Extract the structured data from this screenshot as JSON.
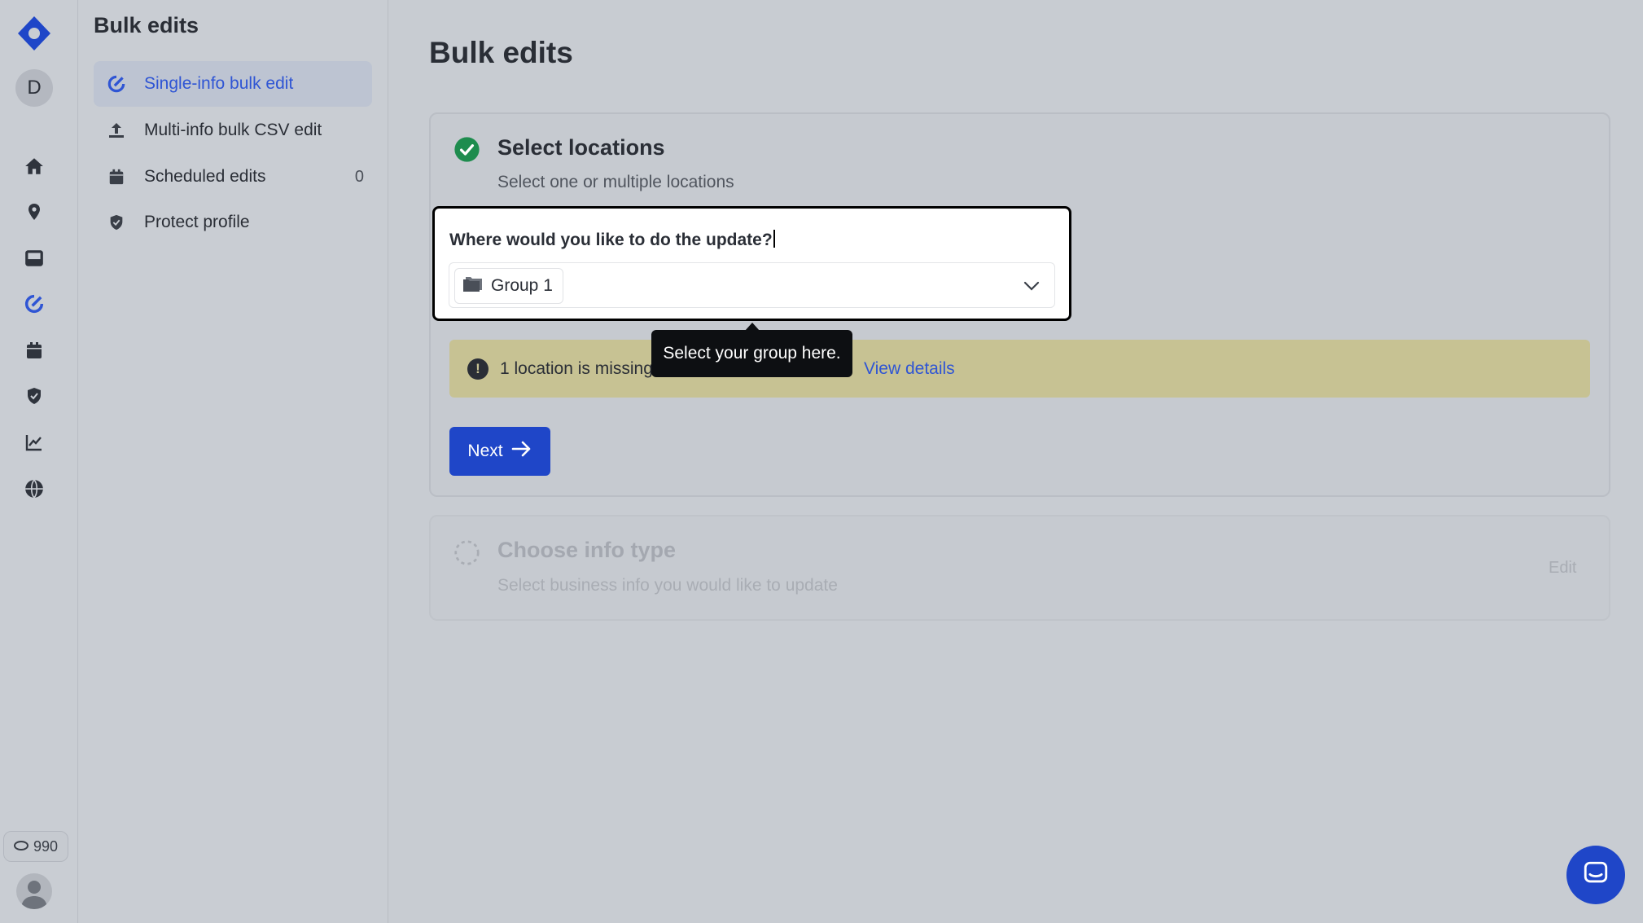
{
  "rail": {
    "avatar_letter": "D",
    "credits": "990",
    "icons": [
      "home-icon",
      "location-pin-icon",
      "inbox-icon",
      "bulk-edit-icon",
      "calendar-icon",
      "shield-icon",
      "chart-icon",
      "globe-icon"
    ]
  },
  "sidebar": {
    "title": "Bulk edits",
    "items": [
      {
        "label": "Single-info bulk edit",
        "active": true
      },
      {
        "label": "Multi-info bulk CSV edit"
      },
      {
        "label": "Scheduled edits",
        "count": "0"
      },
      {
        "label": "Protect profile"
      }
    ]
  },
  "main": {
    "title": "Bulk edits",
    "step1": {
      "title": "Select locations",
      "subtitle": "Select one or multiple locations",
      "question": "Where would you like to do the update?",
      "selected_chip": "Group 1"
    },
    "warning": {
      "text": "1 location is missing",
      "link": "View details"
    },
    "tooltip": "Select your group here.",
    "next_label": "Next",
    "step2": {
      "title": "Choose info type",
      "subtitle": "Select business info you would like to update",
      "edit_label": "Edit"
    }
  },
  "colors": {
    "accent": "#1f46c8",
    "link": "#2f55d4",
    "success": "#1e8c4e",
    "warning_bg": "#c7c293"
  }
}
